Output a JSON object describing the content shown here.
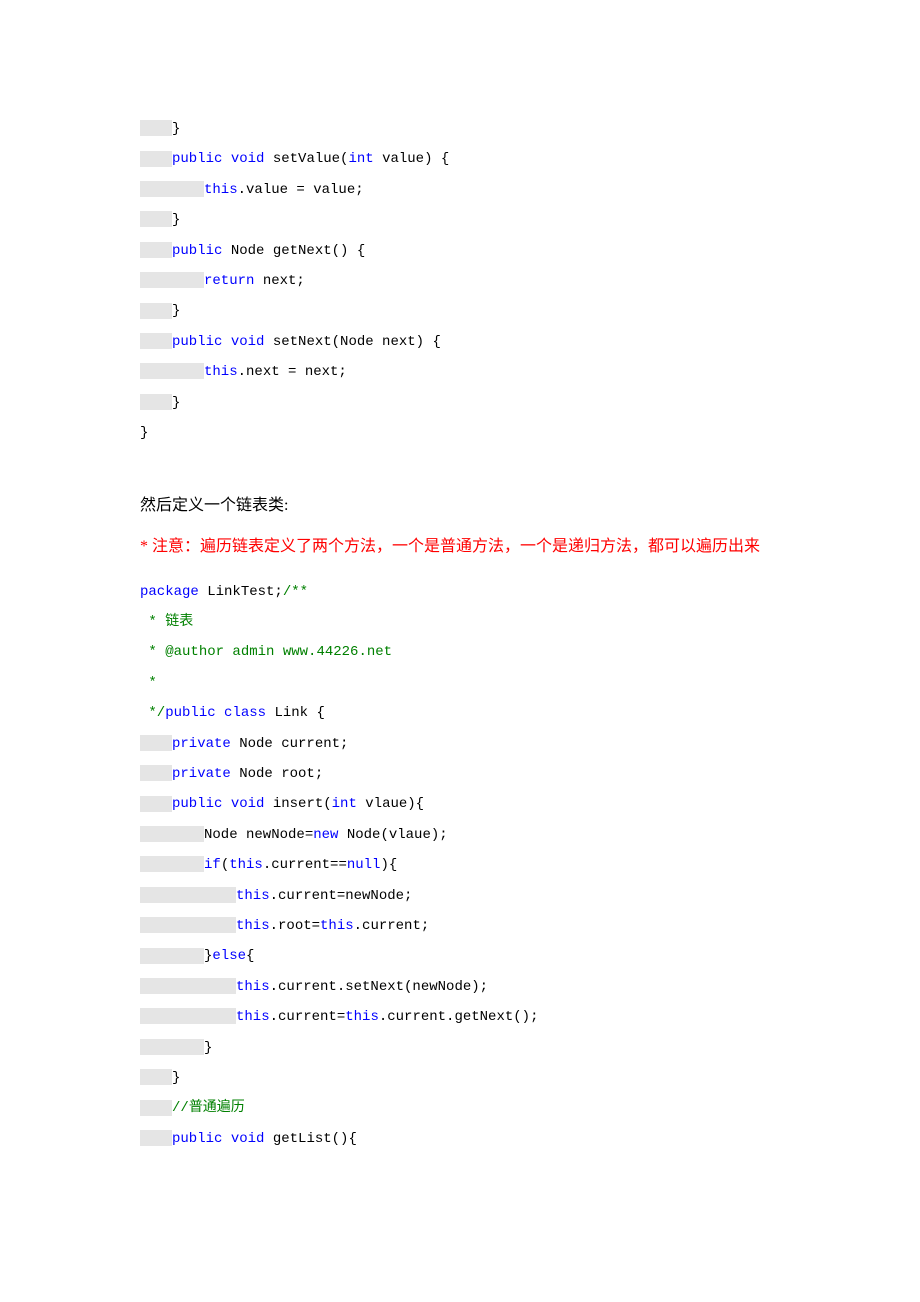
{
  "code1": {
    "l1": "}",
    "l2_a": "public",
    "l2_b": " void",
    "l2_c": " setValue(",
    "l2_d": "int",
    "l2_e": " value) {",
    "l3_a": "this",
    "l3_b": ".value = value;",
    "l4": "}",
    "l5_a": "public",
    "l5_b": " Node getNext() {",
    "l6_a": "return",
    "l6_b": " next;",
    "l7": "}",
    "l8_a": "public",
    "l8_b": " void",
    "l8_c": " setNext(Node next) {",
    "l9_a": "this",
    "l9_b": ".next = next;",
    "l10": "}",
    "l11": "}"
  },
  "text": {
    "define": "然后定义一个链表类:",
    "note": "* 注意：遍历链表定义了两个方法，一个是普通方法，一个是递归方法，都可以遍历出来"
  },
  "code2": {
    "l1_a": "package",
    "l1_b": " LinkTest;",
    "l1_c": "/**",
    "l2_a": " * ",
    "l2_b": "链表",
    "l3_a": " * ",
    "l3_b": "@author",
    "l3_c": " admin www.44226.net",
    "l4": " *",
    "l5_a": " */",
    "l5_b": "public",
    "l5_c": " class",
    "l5_d": " Link {",
    "l6_a": "private",
    "l6_b": " Node current;",
    "l7_a": "private",
    "l7_b": " Node root;",
    "l8_a": "public",
    "l8_b": " void",
    "l8_c": " insert(",
    "l8_d": "int",
    "l8_e": " vlaue){",
    "l9_a": "Node newNode=",
    "l9_b": "new",
    "l9_c": " Node(vlaue);",
    "l10_a": "if",
    "l10_b": "(",
    "l10_c": "this",
    "l10_d": ".current==",
    "l10_e": "null",
    "l10_f": "){",
    "l11_a": "this",
    "l11_b": ".current=newNode;",
    "l12_a": "this",
    "l12_b": ".root=",
    "l12_c": "this",
    "l12_d": ".current;",
    "l13_a": "}",
    "l13_b": "else",
    "l13_c": "{",
    "l14_a": "this",
    "l14_b": ".current.setNext(newNode);",
    "l15_a": "this",
    "l15_b": ".current=",
    "l15_c": "this",
    "l15_d": ".current.getNext();",
    "l16": "}",
    "l17": "}",
    "l18_a": "//",
    "l18_b": "普通遍历",
    "l19_a": "public",
    "l19_b": " void",
    "l19_c": " getList(){"
  }
}
